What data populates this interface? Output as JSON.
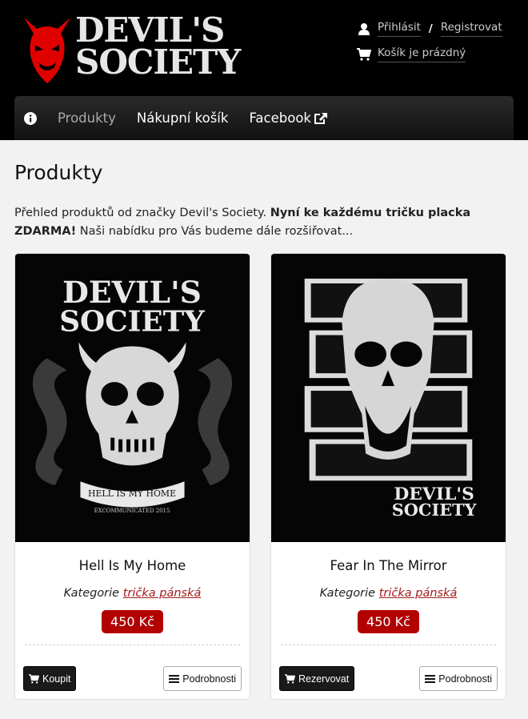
{
  "brand": {
    "line1": "DEVIL'S",
    "line2": "SOCIETY"
  },
  "account": {
    "login": "Přihlásit",
    "separator": "/",
    "register": "Registrovat",
    "cart_status": "Košík je prázdný"
  },
  "nav": {
    "products": "Produkty",
    "cart": "Nákupní košík",
    "facebook": "Facebook"
  },
  "page": {
    "title": "Produkty",
    "intro_plain": "Přehled produktů od značky Devil's Society. ",
    "intro_bold": "Nyní ke každému tričku placka ZDARMA!",
    "intro_rest": " Naši nabídku pro Vás budeme dále rozšiřovat..."
  },
  "products": [
    {
      "name": "Hell Is My Home",
      "category_prefix": "Kategorie",
      "category": "trička pánská",
      "price": "450 Kč",
      "primary_action": "Koupit",
      "details": "Podrobnosti",
      "art_line1": "DEVIL'S",
      "art_line2": "SOCIETY",
      "art_banner": "HELL IS MY HOME",
      "art_caption": "EXCOMMUNICATED 2015"
    },
    {
      "name": "Fear In The Mirror",
      "category_prefix": "Kategorie",
      "category": "trička pánská",
      "price": "450 Kč",
      "primary_action": "Rezervovat",
      "details": "Podrobnosti",
      "art_line1": "DEVIL'S",
      "art_line2": "SOCIETY"
    }
  ],
  "colors": {
    "accent": "#b30000",
    "link": "#a31d1d",
    "header_bg": "#000000"
  }
}
